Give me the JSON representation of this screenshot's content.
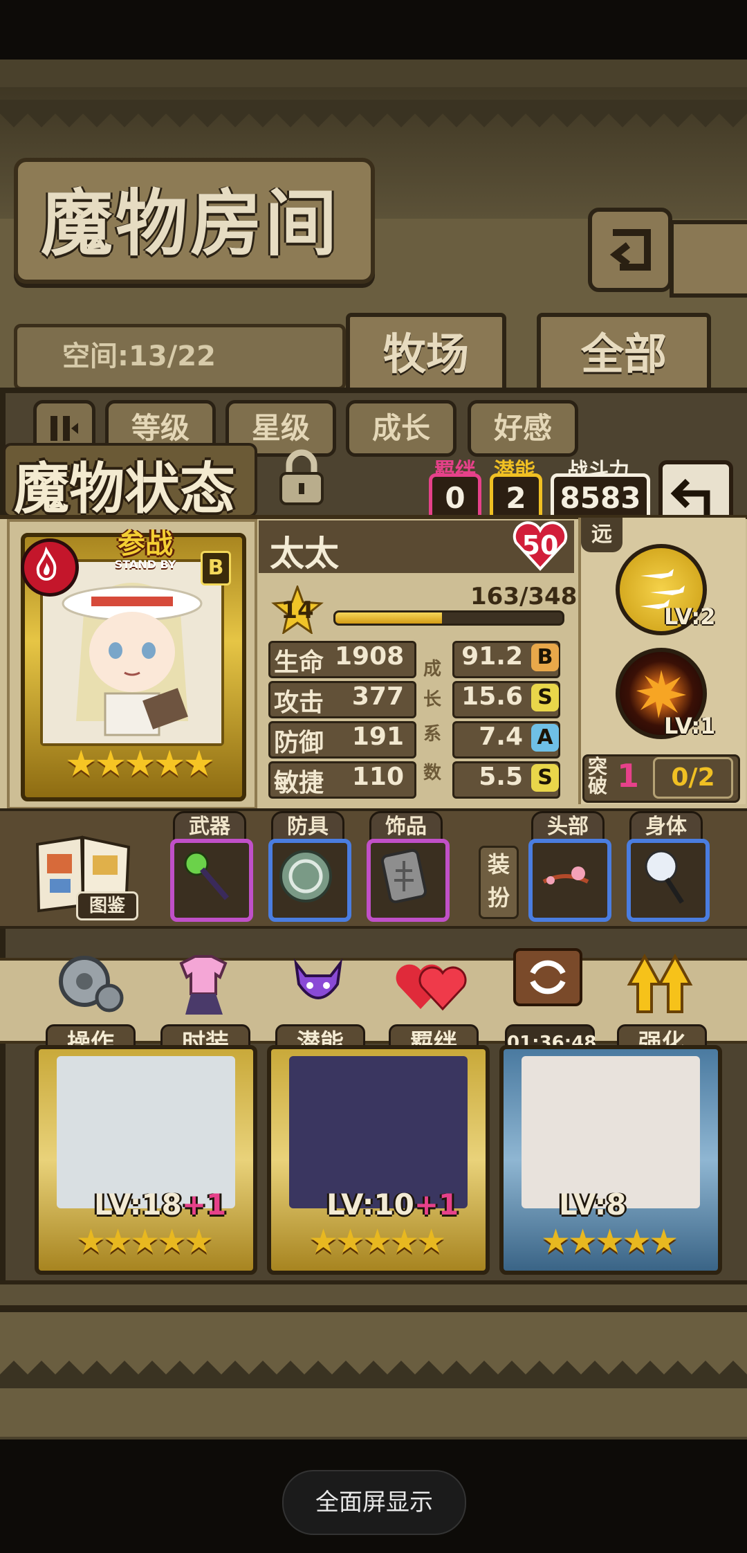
{
  "header": {
    "title": "魔物房间",
    "space": "空间:13/22"
  },
  "tabs": [
    {
      "label": "牧场"
    },
    {
      "label": "全部"
    }
  ],
  "sort": {
    "buttons": [
      "等级",
      "星级",
      "成长",
      "好感"
    ]
  },
  "status": {
    "title": "魔物状态",
    "bond_label": "羁绊",
    "bond_value": "0",
    "potential_label": "潜能",
    "potential_value": "2",
    "power_label": "战斗力",
    "power_value": "8583"
  },
  "card": {
    "standby_cn": "参战",
    "standby_en": "STAND BY",
    "rank_letter": "B",
    "stars": "★★★★★"
  },
  "monster": {
    "name": "太太",
    "affection": "50",
    "level": "14",
    "exp": "163/348",
    "exp_fraction": 0.468
  },
  "stats": [
    {
      "label": "生命",
      "value": "1908",
      "growth": "91.2",
      "grade": "B",
      "color": "#e9a84a"
    },
    {
      "label": "攻击",
      "value": "377",
      "growth": "15.6",
      "grade": "S",
      "color": "#e9d64a"
    },
    {
      "label": "防御",
      "value": "191",
      "growth": "7.4",
      "grade": "A",
      "color": "#6fc0e6"
    },
    {
      "label": "敏捷",
      "value": "110",
      "growth": "5.5",
      "grade": "S",
      "color": "#e9d64a"
    }
  ],
  "growth_label": [
    "成",
    "长",
    "系",
    "数"
  ],
  "skills": {
    "range": "远",
    "items": [
      {
        "level": "LV:2"
      },
      {
        "level": "LV:1"
      }
    ],
    "breakthrough_label": "突破",
    "breakthrough_level": "1",
    "breakthrough_progress": "0/2"
  },
  "equipment": {
    "codex": "图鉴",
    "dress_label": "装扮",
    "slots": [
      {
        "label": "武器",
        "border": "#c050c8"
      },
      {
        "label": "防具",
        "border": "#4a7de0"
      },
      {
        "label": "饰品",
        "border": "#c050c8"
      },
      {
        "label": "头部",
        "border": "#4a7de0"
      },
      {
        "label": "身体",
        "border": "#4a7de0"
      }
    ]
  },
  "actions": [
    {
      "label": "操作"
    },
    {
      "label": "时装"
    },
    {
      "label": "潜能"
    },
    {
      "label": "羁绊"
    },
    {
      "label": "01:36:48"
    },
    {
      "label": "强化"
    }
  ],
  "monsters": [
    {
      "level": "LV:18",
      "plus": "+1",
      "stars": "★★★★★"
    },
    {
      "level": "LV:10",
      "plus": "+1",
      "stars": "★★★★★"
    },
    {
      "level": "LV:8",
      "plus": "",
      "stars": "★★★★★"
    }
  ],
  "system": {
    "fullscreen": "全面屏显示"
  }
}
